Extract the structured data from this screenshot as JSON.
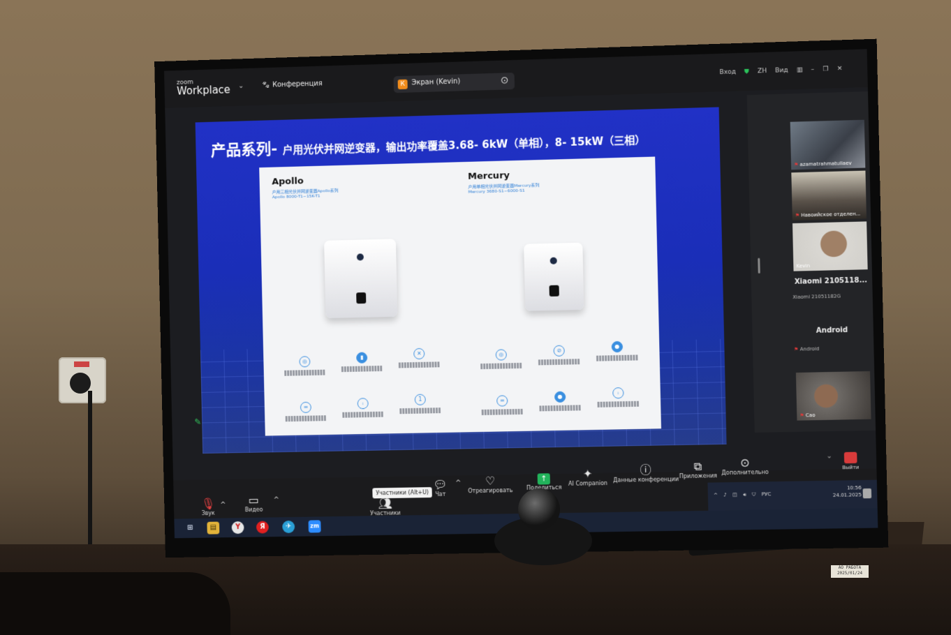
{
  "zoom": {
    "brand_small": "zoom",
    "brand_big": "Workplace",
    "conference_menu": "Конференция",
    "share_badge": "К",
    "share_label": "Экран (Kevin)",
    "right_controls": {
      "signin": "Вход",
      "lang": "ZH",
      "view": "Вид"
    }
  },
  "slide": {
    "title_main": "产品系列-",
    "title_sub": "户用光伏并网逆变器，输出功率覆盖3.68- 6kW（单相），8- 15kW（三相）",
    "cards": [
      {
        "name": "Apollo",
        "line1": "户用三相光伏并网逆变器Apollo系列",
        "line2": "Apollo 8000-T1~15K-T1"
      },
      {
        "name": "Mercury",
        "line1": "户用单相光伏并网逆变器Mercury系列",
        "line2": "Mercury 3680-S1~6000-S1"
      }
    ]
  },
  "gallery": {
    "tiles": [
      {
        "name": "azamatrahmatullaev"
      },
      {
        "name": "Навоийское отделен..."
      },
      {
        "name": "Kevin"
      },
      {
        "big": "Xiaomi 2105118...",
        "small": "Xiaomi 21051182G"
      },
      {
        "big": "Android",
        "small": "Android"
      },
      {
        "name": "Cao"
      }
    ]
  },
  "toolbar": {
    "audio": "Звук",
    "video": "Видео",
    "participants": "Участники",
    "chat": "Чат",
    "react": "Отреагировать",
    "share": "Поделиться",
    "ai": "AI Companion",
    "info": "Данные конференции",
    "apps": "Приложения",
    "more": "Дополнительно",
    "leave": "Выйти",
    "tooltip": "Участники (Alt+U)"
  },
  "tray": {
    "lang": "РУС",
    "time": "10:56",
    "date": "24.01.2025"
  },
  "taskbar": {
    "apps": [
      "⊞",
      "▤",
      "Y",
      "Я",
      "✈",
      "zm"
    ]
  },
  "sticker": {
    "line1": "АО РАБОТА",
    "line2": "2025/01/24"
  },
  "colors": {
    "slide_blue": "#1a2eb8",
    "accent_green": "#22b35b",
    "zoom_orange": "#f08c1c",
    "leave_red": "#d83b3b"
  },
  "icons": [
    "zoom-logo",
    "chevron-down-icon",
    "paw-icon",
    "shield-check-icon",
    "mic-muted-icon",
    "video-icon",
    "people-icon",
    "chat-icon",
    "heart-icon",
    "share-arrow-icon",
    "sparkle-icon",
    "info-icon",
    "apps-icon",
    "ellipsis-icon",
    "exit-icon",
    "pencil-icon",
    "windows-icon"
  ]
}
